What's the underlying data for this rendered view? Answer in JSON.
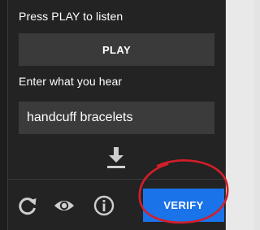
{
  "captcha": {
    "play_prompt": "Press PLAY to listen",
    "play_label": "PLAY",
    "answer_prompt": "Enter what you hear",
    "answer_value": "handcuff bracelets",
    "verify_label": "VERIFY"
  },
  "icons": {
    "download": "download-icon",
    "reload": "reload-icon",
    "visual_challenge": "eye-icon",
    "help": "info-icon"
  },
  "colors": {
    "panel_bg": "#232323",
    "button_bg": "#3a3a3a",
    "verify_blue": "#1a73e8",
    "annotation_red": "#d41e2a",
    "icon_grey": "#cfcfcf"
  }
}
